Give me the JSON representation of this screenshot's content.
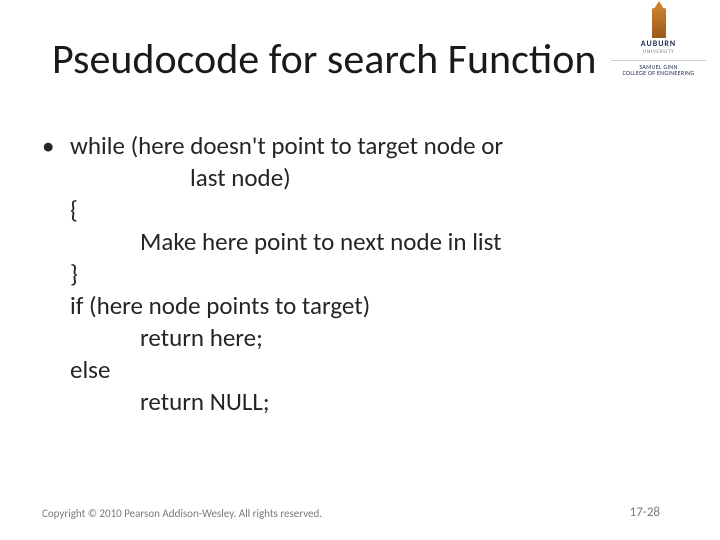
{
  "logo": {
    "university": "AUBURN",
    "sub": "UNIVERSITY",
    "college_line1": "SAMUEL GINN",
    "college_line2": "COLLEGE OF ENGINEERING"
  },
  "title": "Pseudocode for search Function",
  "bullet_marker": "•",
  "lines": {
    "l1": "while (here doesn't point to target node or",
    "l2": "last node)",
    "l3": "{",
    "l4": "Make here point to next node in list",
    "l5": "}",
    "l6": "if (here node points to target)",
    "l7": "return here;",
    "l8": "else",
    "l9": "return NULL;"
  },
  "footer": {
    "copyright": "Copyright © 2010 Pearson Addison-Wesley. All rights reserved.",
    "page": "17-28"
  }
}
